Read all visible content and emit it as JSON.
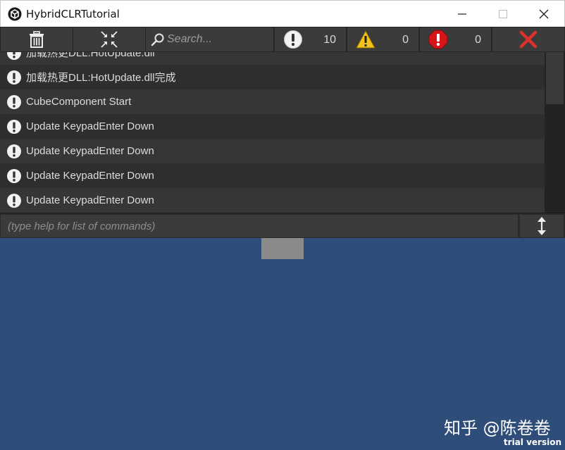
{
  "window": {
    "title": "HybridCLRTutorial"
  },
  "toolbar": {
    "search_placeholder": "Search...",
    "filters": [
      {
        "name": "info",
        "icon": "info-icon",
        "count": "10"
      },
      {
        "name": "warning",
        "icon": "warning-icon",
        "count": "0"
      },
      {
        "name": "error",
        "icon": "error-icon",
        "count": "0"
      }
    ]
  },
  "log": {
    "rows": [
      {
        "text": "加载热更DLL:HotUpdate.dll",
        "icon": "info-icon"
      },
      {
        "text": "加载热更DLL:HotUpdate.dll完成",
        "icon": "info-icon"
      },
      {
        "text": "CubeComponent Start",
        "icon": "info-icon"
      },
      {
        "text": "Update KeypadEnter Down",
        "icon": "info-icon"
      },
      {
        "text": "Update KeypadEnter Down",
        "icon": "info-icon"
      },
      {
        "text": "Update KeypadEnter Down",
        "icon": "info-icon"
      },
      {
        "text": "Update KeypadEnter Down",
        "icon": "info-icon"
      }
    ]
  },
  "command": {
    "placeholder": "(type help for list of commands)"
  },
  "overlay": {
    "watermark": "知乎 @陈卷卷",
    "trial": "trial version"
  },
  "colors": {
    "background": "#2f4d79",
    "warning": "#f3c21b",
    "error": "#d8141b",
    "close": "#d8322b"
  }
}
